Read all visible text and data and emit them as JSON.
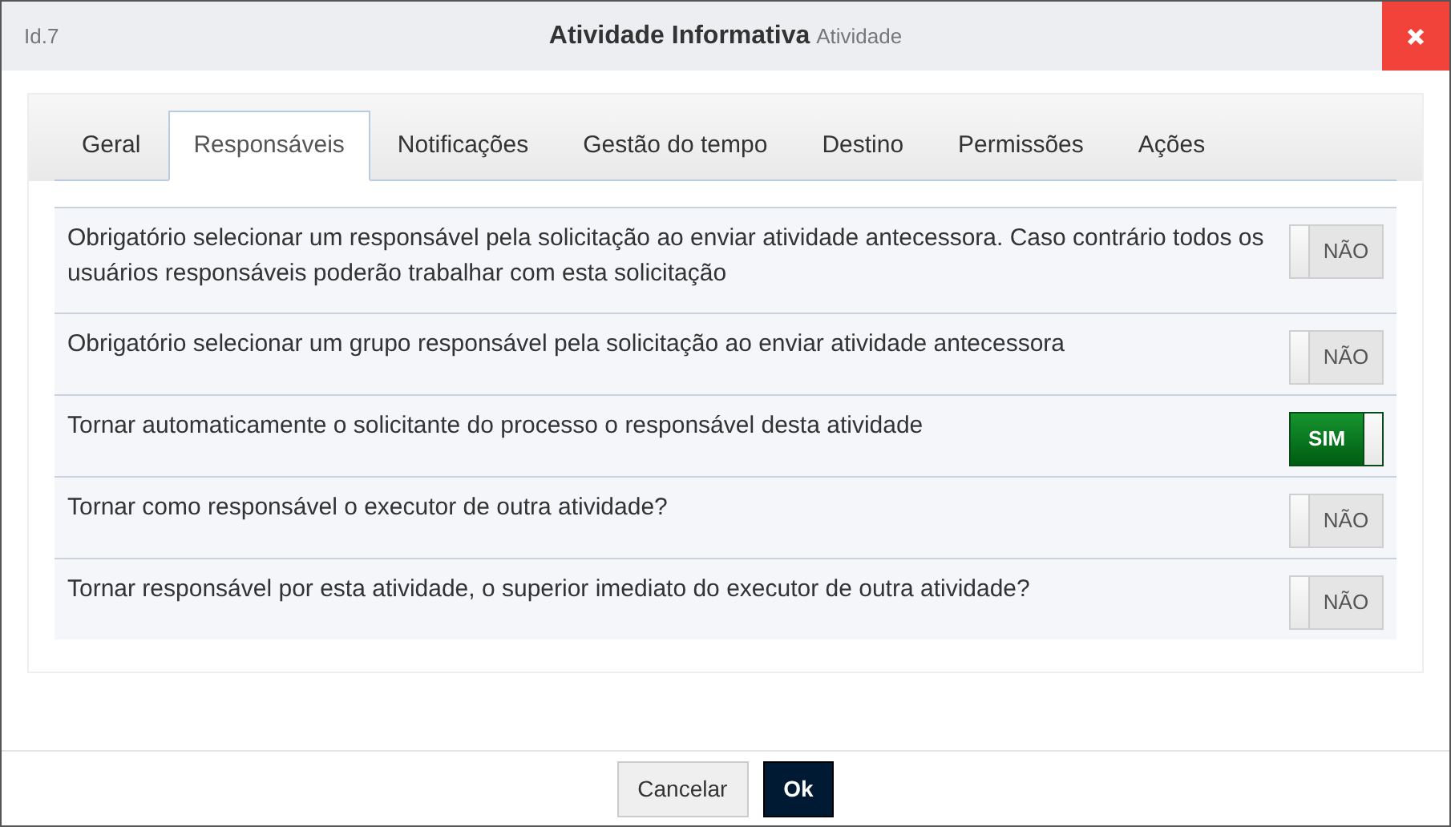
{
  "window": {
    "id": "Id.7",
    "title": "Atividade Informativa",
    "subtitle": "Atividade"
  },
  "tabs": [
    {
      "label": "Geral",
      "selected": false
    },
    {
      "label": "Responsáveis",
      "selected": true
    },
    {
      "label": "Notificações",
      "selected": false
    },
    {
      "label": "Gestão do tempo",
      "selected": false
    },
    {
      "label": "Destino",
      "selected": false
    },
    {
      "label": "Permissões",
      "selected": false
    },
    {
      "label": "Ações",
      "selected": false
    }
  ],
  "settings": [
    {
      "label": "Obrigatório selecionar um responsável pela solicitação ao enviar atividade antecessora. Caso contrário todos os usuários responsáveis poderão trabalhar com esta solicitação",
      "on": false,
      "toggle_text": "NÃO"
    },
    {
      "label": "Obrigatório selecionar um grupo responsável pela solicitação ao enviar atividade antecessora",
      "on": false,
      "toggle_text": "NÃO"
    },
    {
      "label": "Tornar automaticamente o solicitante do processo o responsável desta atividade",
      "on": true,
      "toggle_text": "SIM"
    },
    {
      "label": "Tornar como responsável o executor de outra atividade?",
      "on": false,
      "toggle_text": "NÃO"
    },
    {
      "label": "Tornar responsável por esta atividade, o superior imediato do executor de outra atividade?",
      "on": false,
      "toggle_text": "NÃO"
    }
  ],
  "buttons": [
    {
      "label": "Cancelar",
      "kind": "secondary"
    },
    {
      "label": "Ok",
      "kind": "primary"
    }
  ]
}
